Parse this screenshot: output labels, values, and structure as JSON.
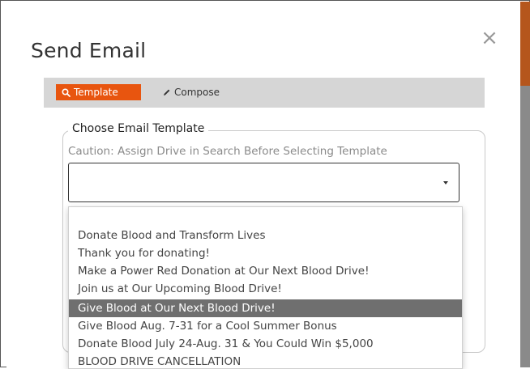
{
  "modal": {
    "title": "Send Email",
    "close_glyph": "×"
  },
  "tabs": [
    {
      "label": "Template",
      "icon": "search-icon",
      "active": true
    },
    {
      "label": "Compose",
      "icon": "pencil-icon",
      "active": false
    }
  ],
  "template_picker": {
    "legend": "Choose Email Template",
    "caution": "Caution: Assign Drive in Search Before Selecting Template",
    "selected_value": "",
    "options": [
      "Donate Blood and Transform Lives",
      "Thank you for donating!",
      "Make a Power Red Donation at Our Next Blood Drive!",
      "Join us at Our Upcoming Blood Drive!",
      "Give Blood at Our Next Blood Drive!",
      "Give Blood Aug. 7-31 for a Cool Summer Bonus",
      "Donate Blood July 24-Aug. 31 & You Could Win $5,000",
      "BLOOD DRIVE CANCELLATION"
    ],
    "highlighted_index": 4
  },
  "colors": {
    "accent": "#e8550f",
    "tab_bar": "#d6d6d6",
    "highlight": "#6f6f6f"
  }
}
